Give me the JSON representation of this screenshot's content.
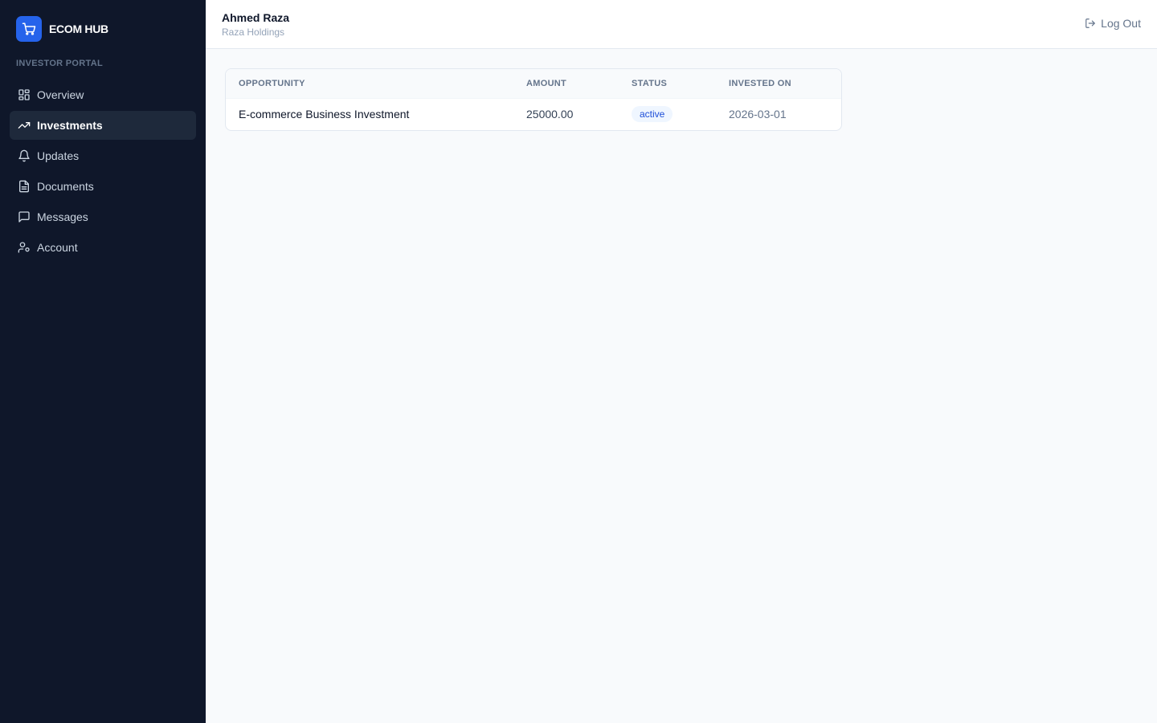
{
  "brand": {
    "name": "ECOM HUB",
    "icon": "cart-icon",
    "accent": "#2563eb"
  },
  "sidebar": {
    "section_label": "INVESTOR PORTAL",
    "items": [
      {
        "label": "Overview",
        "icon": "grid-icon",
        "active": false
      },
      {
        "label": "Investments",
        "icon": "trending-up-icon",
        "active": true
      },
      {
        "label": "Updates",
        "icon": "bell-icon",
        "active": false
      },
      {
        "label": "Documents",
        "icon": "document-icon",
        "active": false
      },
      {
        "label": "Messages",
        "icon": "message-icon",
        "active": false
      },
      {
        "label": "Account",
        "icon": "user-icon",
        "active": false
      }
    ]
  },
  "header": {
    "user_name": "Ahmed Raza",
    "company": "Raza Holdings",
    "logout_label": "Log Out"
  },
  "investments_table": {
    "columns": [
      "OPPORTUNITY",
      "AMOUNT",
      "STATUS",
      "INVESTED ON"
    ],
    "rows": [
      {
        "opportunity": "E-commerce Business Investment",
        "amount": "25000.00",
        "status": "active",
        "invested_on": "2026-03-01"
      }
    ]
  }
}
